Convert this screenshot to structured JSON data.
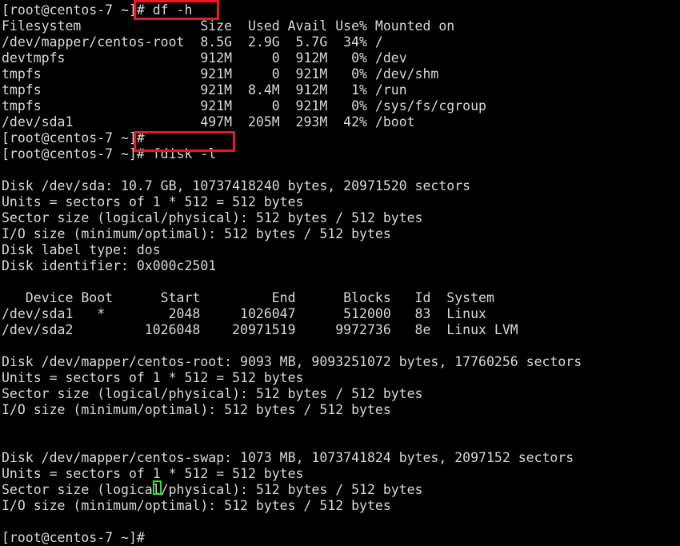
{
  "terminal": {
    "title": "root@centos-7 terminal",
    "background_color": "#000000",
    "text_color": "#d8d8d8",
    "highlight_color": "#f01425",
    "cursor_color": "#2ee02e",
    "prompt": "[root@centos-7 ~]#",
    "cursor_glyph": " ",
    "lines": [
      "[root@centos-7 ~]# df -h",
      "Filesystem               Size  Used Avail Use% Mounted on",
      "/dev/mapper/centos-root  8.5G  2.9G  5.7G  34% /",
      "devtmpfs                 912M     0  912M   0% /dev",
      "tmpfs                    921M     0  921M   0% /dev/shm",
      "tmpfs                    921M  8.4M  912M   1% /run",
      "tmpfs                    921M     0  921M   0% /sys/fs/cgroup",
      "/dev/sda1                497M  205M  293M  42% /boot",
      "[root@centos-7 ~]#",
      "[root@centos-7 ~]# fdisk -l",
      "",
      "Disk /dev/sda: 10.7 GB, 10737418240 bytes, 20971520 sectors",
      "Units = sectors of 1 * 512 = 512 bytes",
      "Sector size (logical/physical): 512 bytes / 512 bytes",
      "I/O size (minimum/optimal): 512 bytes / 512 bytes",
      "Disk label type: dos",
      "Disk identifier: 0x000c2501",
      "",
      "   Device Boot      Start         End      Blocks   Id  System",
      "/dev/sda1   *        2048     1026047      512000   83  Linux",
      "/dev/sda2         1026048    20971519     9972736   8e  Linux LVM",
      "",
      "Disk /dev/mapper/centos-root: 9093 MB, 9093251072 bytes, 17760256 sectors",
      "Units = sectors of 1 * 512 = 512 bytes",
      "Sector size (logical/physical): 512 bytes / 512 bytes",
      "I/O size (minimum/optimal): 512 bytes / 512 bytes",
      "",
      "",
      "Disk /dev/mapper/centos-swap: 1073 MB, 1073741824 bytes, 2097152 sectors",
      "Units = sectors of 1 * 512 = 512 bytes",
      "Sector size (logical/physical): 512 bytes / 512 bytes",
      "I/O size (minimum/optimal): 512 bytes / 512 bytes",
      "",
      "[root@centos-7 ~]# "
    ]
  },
  "commands": {
    "first": "df -h",
    "second": "fdisk -l"
  },
  "df_table": {
    "headers": [
      "Filesystem",
      "Size",
      "Used",
      "Avail",
      "Use%",
      "Mounted on"
    ],
    "rows": [
      [
        "/dev/mapper/centos-root",
        "8.5G",
        "2.9G",
        "5.7G",
        "34%",
        "/"
      ],
      [
        "devtmpfs",
        "912M",
        "0",
        "912M",
        "0%",
        "/dev"
      ],
      [
        "tmpfs",
        "921M",
        "0",
        "921M",
        "0%",
        "/dev/shm"
      ],
      [
        "tmpfs",
        "921M",
        "8.4M",
        "912M",
        "1%",
        "/run"
      ],
      [
        "tmpfs",
        "921M",
        "0",
        "921M",
        "0%",
        "/sys/fs/cgroup"
      ],
      [
        "/dev/sda1",
        "497M",
        "205M",
        "293M",
        "42%",
        "/boot"
      ]
    ]
  },
  "fdisk": {
    "disks": [
      {
        "name": "/dev/sda",
        "size_human": "10.7 GB",
        "bytes": "10737418240",
        "sectors": "20971520",
        "units": "sectors of 1 * 512 = 512 bytes",
        "sector_size": "512 bytes / 512 bytes",
        "io_size": "512 bytes / 512 bytes",
        "label_type": "dos",
        "identifier": "0x000c2501"
      },
      {
        "name": "/dev/mapper/centos-root",
        "size_human": "9093 MB",
        "bytes": "9093251072",
        "sectors": "17760256",
        "units": "sectors of 1 * 512 = 512 bytes",
        "sector_size": "512 bytes / 512 bytes",
        "io_size": "512 bytes / 512 bytes"
      },
      {
        "name": "/dev/mapper/centos-swap",
        "size_human": "1073 MB",
        "bytes": "1073741824",
        "sectors": "2097152",
        "units": "sectors of 1 * 512 = 512 bytes",
        "sector_size": "512 bytes / 512 bytes",
        "io_size": "512 bytes / 512 bytes"
      }
    ],
    "partition_table": {
      "headers": [
        "Device",
        "Boot",
        "Start",
        "End",
        "Blocks",
        "Id",
        "System"
      ],
      "rows": [
        [
          "/dev/sda1",
          "*",
          "2048",
          "1026047",
          "512000",
          "83",
          "Linux"
        ],
        [
          "/dev/sda2",
          "",
          "1026048",
          "20971519",
          "9972736",
          "8e",
          "Linux LVM"
        ]
      ]
    }
  }
}
